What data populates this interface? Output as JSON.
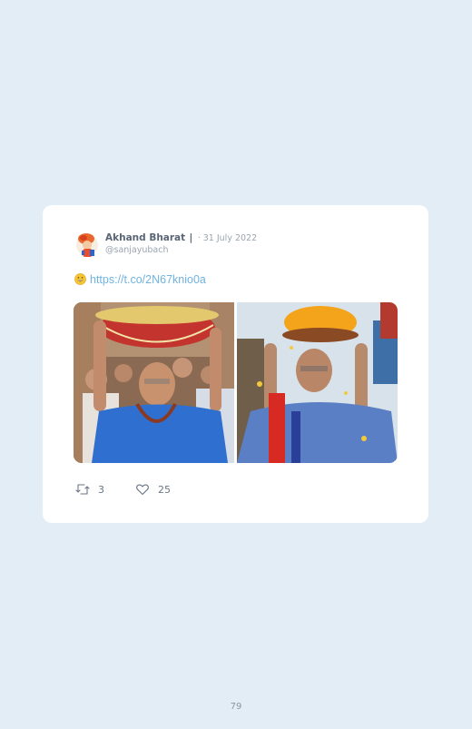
{
  "tweet": {
    "author_name": "Akhand Bharat",
    "separator": "|",
    "date": "· 31 July 2022",
    "handle": "@sanjayubach",
    "link": "https://t.co/2N67knio0a",
    "images": [
      {
        "icon": "photo-left"
      },
      {
        "icon": "photo-right"
      }
    ],
    "actions": {
      "retweet_count": "3",
      "like_count": "25"
    }
  },
  "page": {
    "number": "79"
  },
  "colors": {
    "background": "#e2edf5",
    "card": "#ffffff",
    "link": "#6fb3e0",
    "text_muted": "#9aa4b0",
    "text_name": "#5a6575"
  }
}
